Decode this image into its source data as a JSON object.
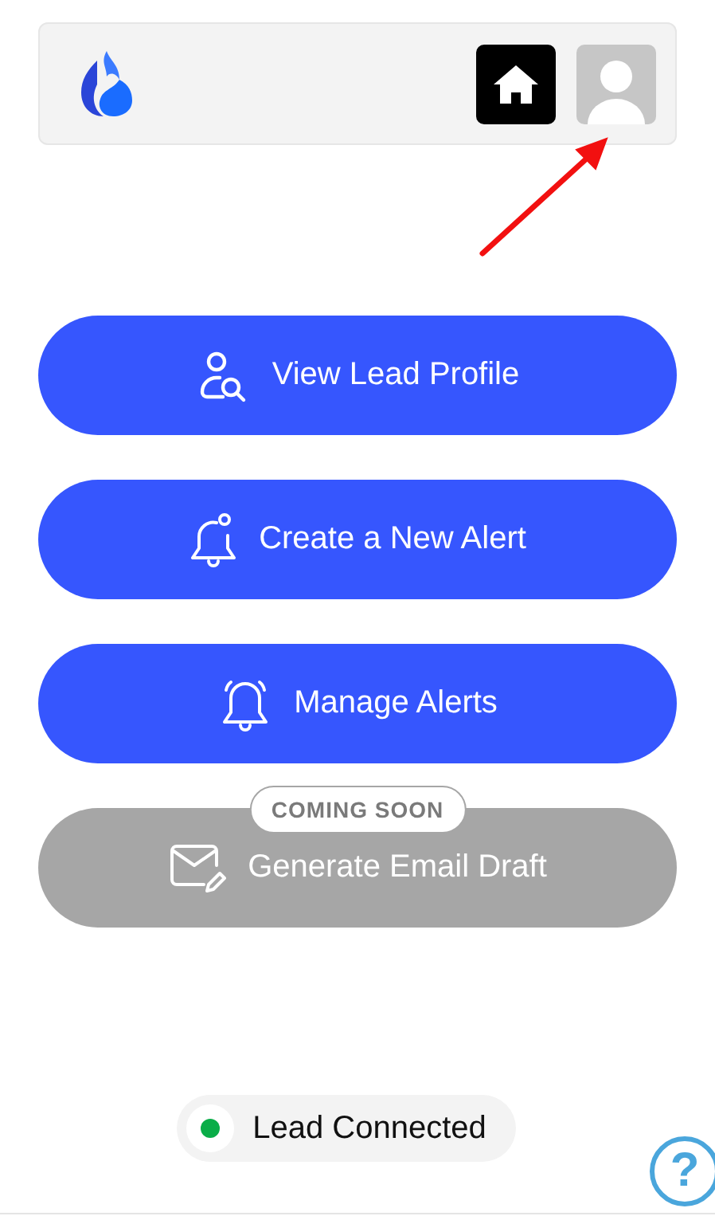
{
  "header": {
    "nav_buttons": [
      {
        "kind": "home"
      },
      {
        "kind": "avatar"
      }
    ]
  },
  "actions": [
    {
      "kind": "profile",
      "label": "View Lead Profile",
      "disabled": false
    },
    {
      "kind": "new-alert",
      "label": "Create a New Alert",
      "disabled": false
    },
    {
      "kind": "alerts",
      "label": "Manage Alerts",
      "disabled": false
    },
    {
      "kind": "email",
      "label": "Generate Email Draft",
      "disabled": true,
      "badge": "COMING SOON"
    }
  ],
  "status": {
    "label": "Lead Connected",
    "color": "#0aad48"
  },
  "help": {
    "label": "?"
  }
}
